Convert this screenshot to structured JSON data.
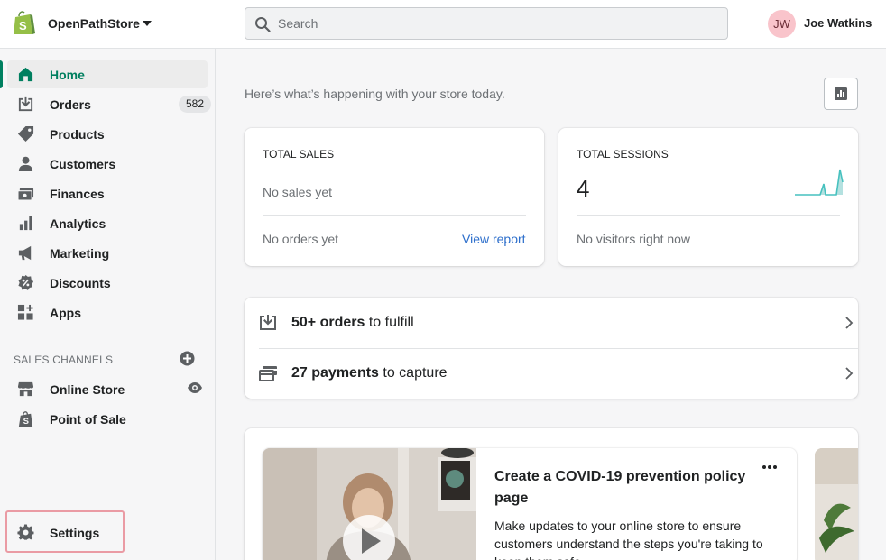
{
  "store": {
    "name": "OpenPathStore"
  },
  "search": {
    "placeholder": "Search"
  },
  "user": {
    "initials": "JW",
    "name": "Joe Watkins"
  },
  "nav": {
    "items": [
      {
        "label": "Home",
        "icon": "home-icon",
        "active": true
      },
      {
        "label": "Orders",
        "icon": "orders-icon",
        "badge": "582"
      },
      {
        "label": "Products",
        "icon": "tag-icon"
      },
      {
        "label": "Customers",
        "icon": "person-icon"
      },
      {
        "label": "Finances",
        "icon": "finances-icon"
      },
      {
        "label": "Analytics",
        "icon": "bar-chart-icon"
      },
      {
        "label": "Marketing",
        "icon": "megaphone-icon"
      },
      {
        "label": "Discounts",
        "icon": "discount-icon"
      },
      {
        "label": "Apps",
        "icon": "apps-icon"
      }
    ],
    "sales_channels_title": "SALES CHANNELS",
    "channels": [
      {
        "label": "Online Store",
        "icon": "store-icon"
      },
      {
        "label": "Point of Sale",
        "icon": "pos-icon"
      }
    ],
    "settings_label": "Settings"
  },
  "main": {
    "greeting": "Here’s what’s happening with your store today.",
    "total_sales": {
      "title": "TOTAL SALES",
      "subtitle": "No sales yet",
      "footer": "No orders yet",
      "link": "View report"
    },
    "total_sessions": {
      "title": "TOTAL SESSIONS",
      "value": "4",
      "footer": "No visitors right now"
    },
    "todos": [
      {
        "bold": "50+ orders",
        "rest": " to fulfill",
        "icon": "fulfill-icon"
      },
      {
        "bold": "27 payments",
        "rest": " to capture",
        "icon": "payment-icon"
      }
    ],
    "card": {
      "title": "Create a COVID-19 prevention policy page",
      "description": "Make updates to your online store to ensure customers understand the steps you're taking to keep them safe"
    }
  },
  "colors": {
    "accent": "#008060",
    "link": "#2c6ecb",
    "highlight": "#ea9ba4",
    "sparkline": "#47c1bf"
  }
}
